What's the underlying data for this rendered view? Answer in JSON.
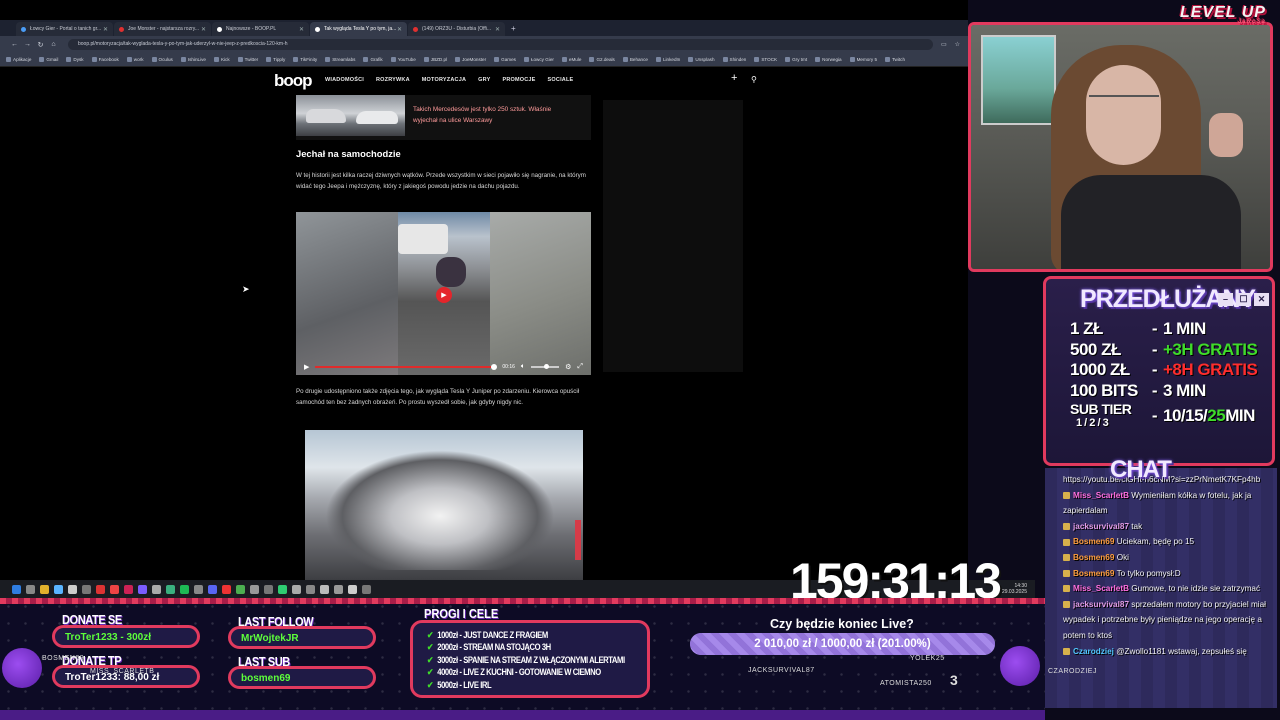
{
  "browser": {
    "tabs": [
      {
        "label": "Łowcy Gier - Portal o tanich gr...",
        "color": "#4a9cf5",
        "active": false
      },
      {
        "label": "Joe Monster - najstarsza rozry...",
        "color": "#e03030",
        "active": false
      },
      {
        "label": "Najnowsze - BOOP.PL",
        "color": "#ffffff",
        "active": false
      },
      {
        "label": "Tak wygląda Tesla Y po tym, ja...",
        "color": "#ffffff",
        "active": true
      },
      {
        "label": "(149) ORZ3U - Disturbia (Offi...",
        "color": "#e03030",
        "active": false
      }
    ],
    "new_tab": "+",
    "url": "boop.pl/motoryzacja/tak-wyglada-tesla-y-po-tym-jak-uderzyl-w-nie-jeep-z-predkoscia-120-km-h",
    "bookmarks": [
      "Aplikacje",
      "Gmail",
      "Dysk",
      "Facebook",
      "work",
      "Oculus",
      "IshinLive",
      "Kick",
      "Twitter",
      "Tipply",
      "TikFinity",
      "Streamlabs",
      "Grafik",
      "YouTube",
      "JBZD.pl",
      "JoeMonster",
      "Games",
      "Łowcy Gier",
      "eMule",
      "G2.deals",
      "Behance",
      "LinkedIn",
      "Unsplash",
      "Shinden",
      "STOCK",
      "Gry tmt",
      "Norwegia",
      "Memory 5",
      "Twitch"
    ]
  },
  "site": {
    "logo": "boop",
    "menu": [
      "WIADOMOŚCI",
      "ROZRYWKA",
      "MOTORYZACJA",
      "GRY",
      "PROMOCJE",
      "SOCIALE"
    ],
    "related_title": "Takich Mercedesów jest tylko 250 sztuk. Właśnie wyjechał na ulice Warszawy",
    "heading": "Jechał na samochodzie",
    "paragraph1": "W tej historii jest kilka raczej dziwnych wątków. Przede wszystkim w sieci pojawiło się nagranie, na którym widać tego Jeepa i mężczyznę, który z jakiegoś powodu jedzie na dachu pojazdu.",
    "video_time": "00:16",
    "video_progress": 0.97,
    "paragraph2": "Po drugie udostępniono także zdjęcia tego, jak wygląda Tesla Y Juniper po zdarzeniu. Kierowca opuścił samochód ten bez żadnych obrażeń. Po prostu wyszedł sobie, jak gdyby nigdy nic."
  },
  "taskbar": {
    "time": "14:30",
    "date": "29.03.2025"
  },
  "overlay": {
    "levelup": "LEVEL UP",
    "levelup_sub": "JaRoSa",
    "panel_title": "PRZEDŁUŻANY",
    "window_buttons": [
      "–",
      "☐",
      "✕"
    ],
    "rates": [
      {
        "left": "1 ZŁ",
        "right": "1 MIN"
      },
      {
        "left": "500 ZŁ",
        "right": "+3H GRATIS"
      },
      {
        "left": "1000 ZŁ",
        "right": "+8H GRATIS"
      },
      {
        "left": "100 BITS",
        "right": "3 MIN"
      }
    ],
    "sub_tier": {
      "label": "SUB TIER",
      "tiers": "1 / 2 / 3",
      "values": "10/15/",
      "highlight": "25",
      "unit": " MIN"
    },
    "chat_title": "CHAT",
    "chat": [
      {
        "user": "",
        "text": "https://youtu.be/clGHt-h6cNM?si=zzPrNmetK7KFp4hb",
        "cls": ""
      },
      {
        "user": "Miss_ScarletB",
        "text": "Wymieniłam kółka w fotelu, jak ja zapierdalam",
        "cls": "u1"
      },
      {
        "user": "jacksurvival87",
        "text": "tak",
        "cls": "u2"
      },
      {
        "user": "Bosmen69",
        "text": "Uciekam, będę po 15",
        "cls": "u3"
      },
      {
        "user": "Bosmen69",
        "text": "Oki",
        "cls": "u3"
      },
      {
        "user": "Bosmen69",
        "text": "To tylko pomysł:D",
        "cls": "u3"
      },
      {
        "user": "Miss_ScarletB",
        "text": "Gumowe, to nie idzie sie zatrzymać",
        "cls": "u1"
      },
      {
        "user": "jacksurvival87",
        "text": "sprzedałem motory bo przyjaciel miał wypadek i potrzebne były pieniądze na jego operację a potem to ktoś",
        "cls": "u2"
      },
      {
        "user": "Czarodziej",
        "text": "@Zwollo1181 wstawaj, zepsułeś się",
        "cls": "u4"
      }
    ],
    "timer": "159:31:13",
    "donate_label": "DONATE SE",
    "donate_value": "TroTer1233 - 300zł",
    "donate_tp_label": "DONATE TP",
    "donate_tp_value": "TroTer1233: 88,00 zł",
    "last_follow_label": "LAST FOLLOW",
    "last_follow_value": "MrWojtekJR",
    "last_sub_label": "LAST SUB",
    "last_sub_value": "bosmen69",
    "goals_title": "PROGI I CELE",
    "goals": [
      {
        "amount": "1000zł",
        "text": "JUST DANCE Z FRAGIEM"
      },
      {
        "amount": "2000zł",
        "text": "STREAM NA STOJĄCO 3H"
      },
      {
        "amount": "3000zł",
        "text": "SPANIE NA STREAM Z WŁĄCZONYMI ALERTAMI"
      },
      {
        "amount": "4000zł",
        "text": "LIVE Z KUCHNI - GOTOWANIE W CIEMNO"
      },
      {
        "amount": "5000zł",
        "text": "LIVE IRL"
      }
    ],
    "countdown_title": "Czy będzie koniec Live?",
    "countdown_bar": "2 010,00 zł / 1000,00 zł (201.00%)",
    "countdown_progress": 1.0,
    "sprites": [
      "BOSMEN69",
      "MISS_SCARLETB",
      "JACKSURVIVAL87",
      "YOLEK25",
      "ATOMISTA250",
      "CZARODZIEJ"
    ],
    "counter": "3"
  }
}
